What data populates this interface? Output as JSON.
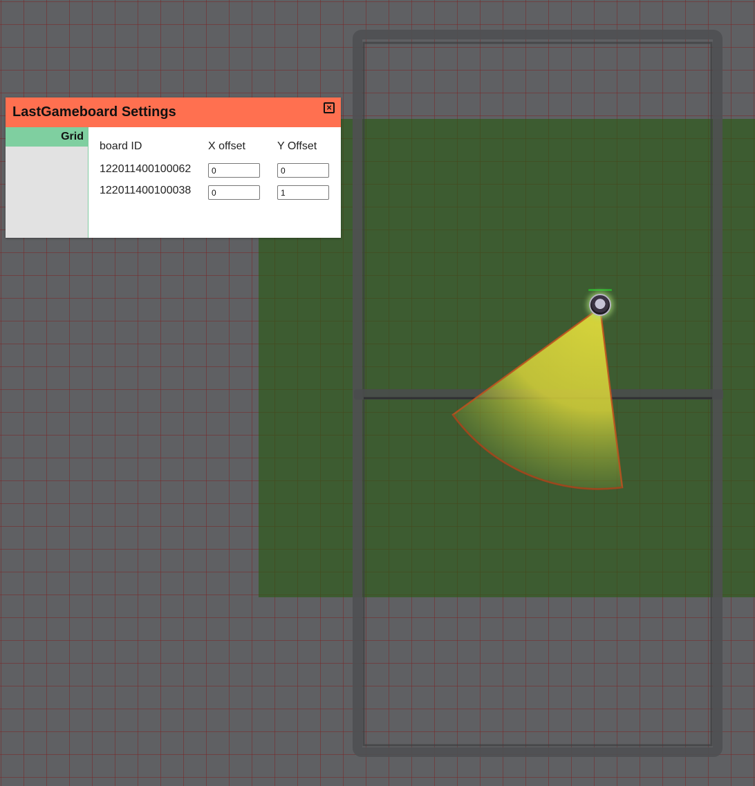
{
  "dialog": {
    "title": "LastGameboard Settings",
    "close_icon": "close-icon",
    "tabs": [
      {
        "label": "Grid",
        "active": true
      }
    ]
  },
  "grid_table": {
    "headers": [
      "board ID",
      "X offset",
      "Y Offset"
    ],
    "rows": [
      {
        "board_id": "122011400100062",
        "x_offset": "0",
        "y_offset": "0"
      },
      {
        "board_id": "122011400100038",
        "x_offset": "0",
        "y_offset": "1"
      }
    ]
  },
  "colors": {
    "header_accent": "#ff7050",
    "active_tab": "#7fcfa0",
    "board_background": "#5f6063",
    "lit_area": "#2d5a14",
    "vision_cone": "#d8d03a"
  },
  "map": {
    "token_icon": "character-token-icon"
  }
}
